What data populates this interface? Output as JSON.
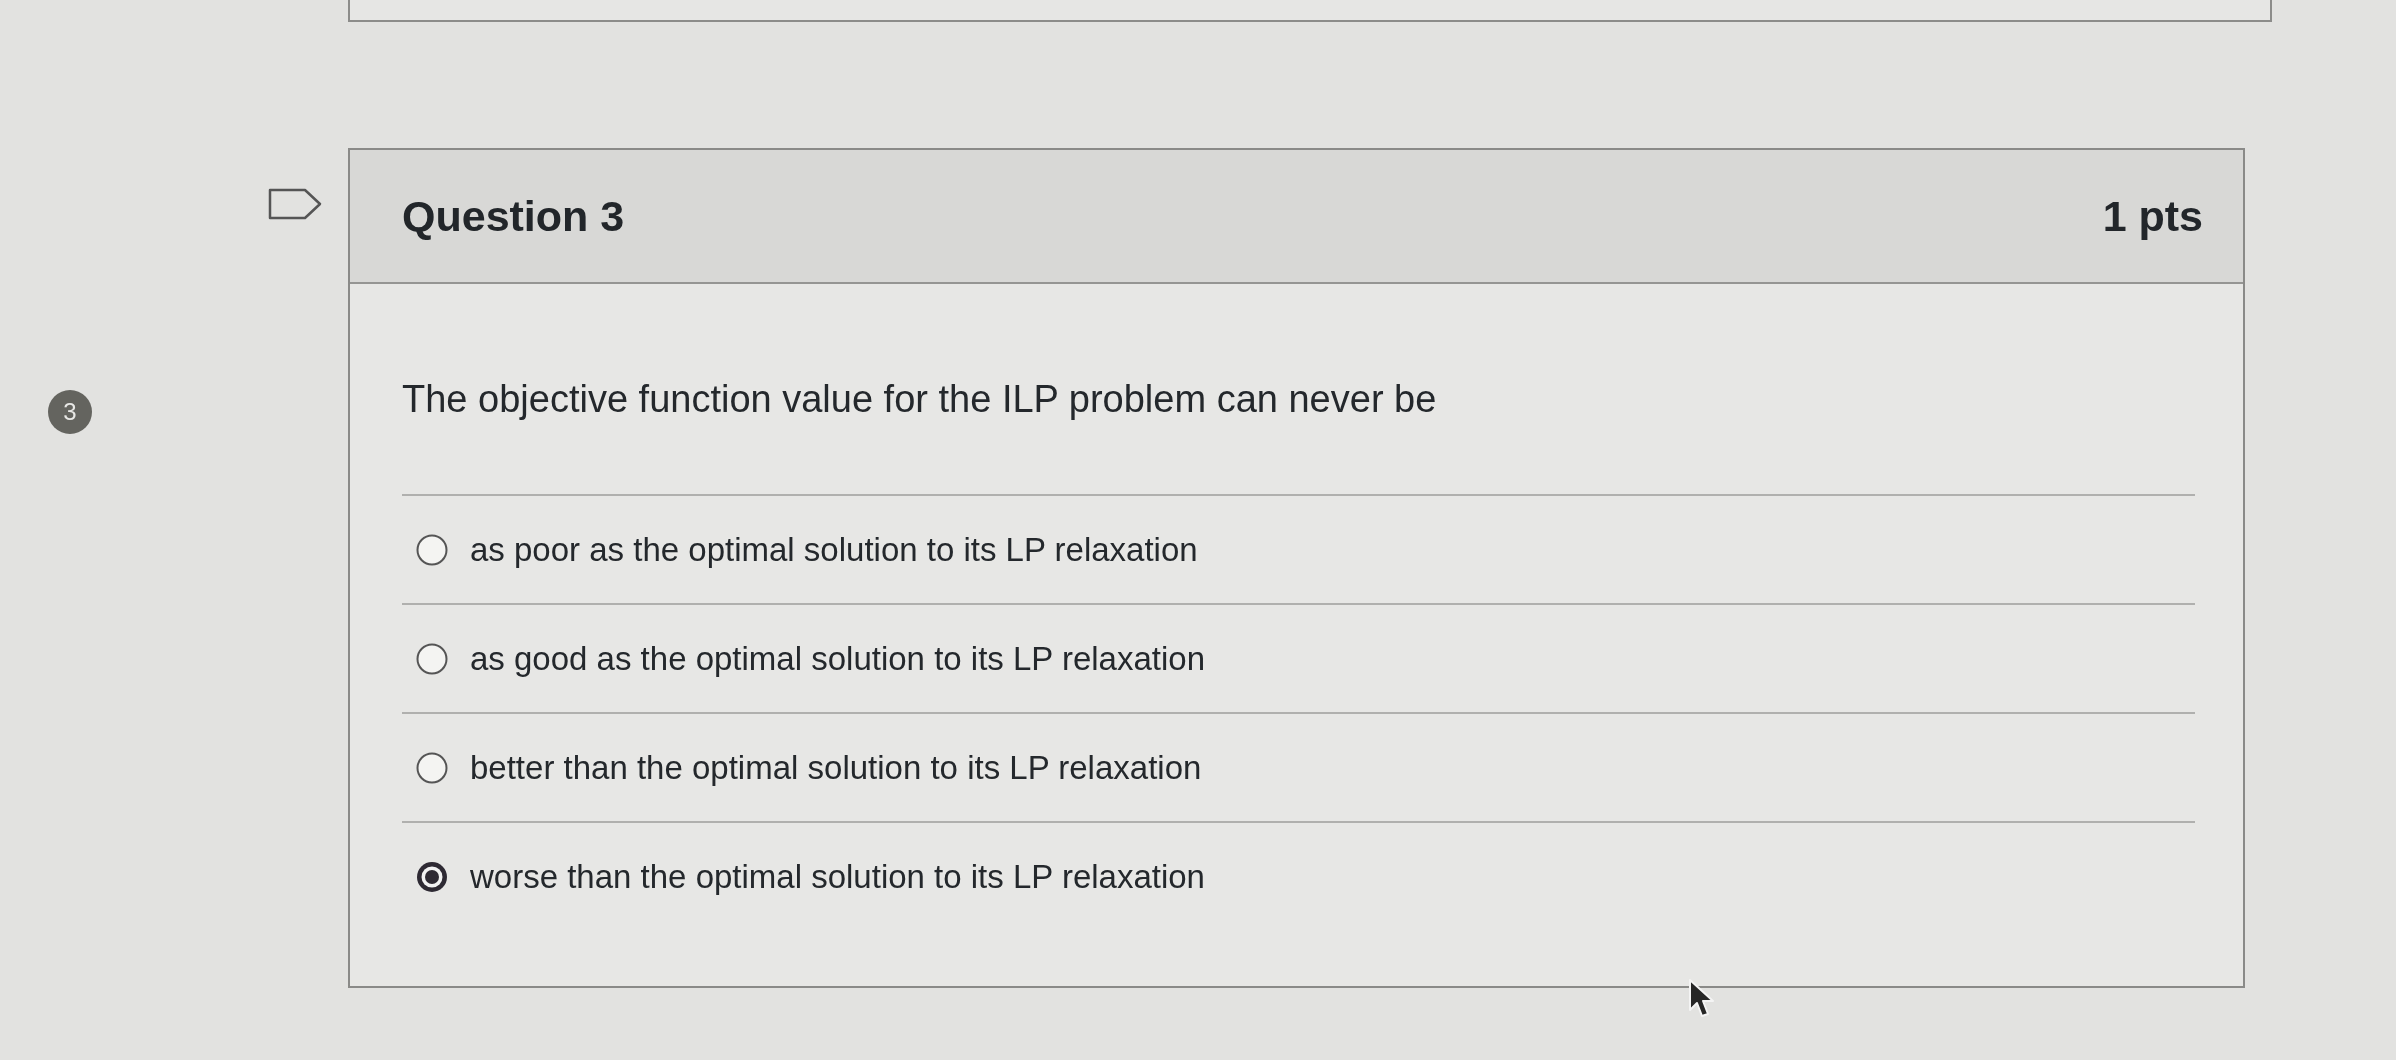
{
  "question_number": "3",
  "question": {
    "flagged": false,
    "title": "Question 3",
    "points": "1 pts",
    "text": "The objective function value for the ILP problem can never be",
    "options": [
      {
        "label": "as poor as the optimal solution to its LP relaxation",
        "selected": false
      },
      {
        "label": "as good as the optimal solution to its LP relaxation",
        "selected": false
      },
      {
        "label": "better than the optimal solution to its LP relaxation",
        "selected": false
      },
      {
        "label": "worse than the optimal solution to its LP relaxation",
        "selected": true
      }
    ]
  }
}
